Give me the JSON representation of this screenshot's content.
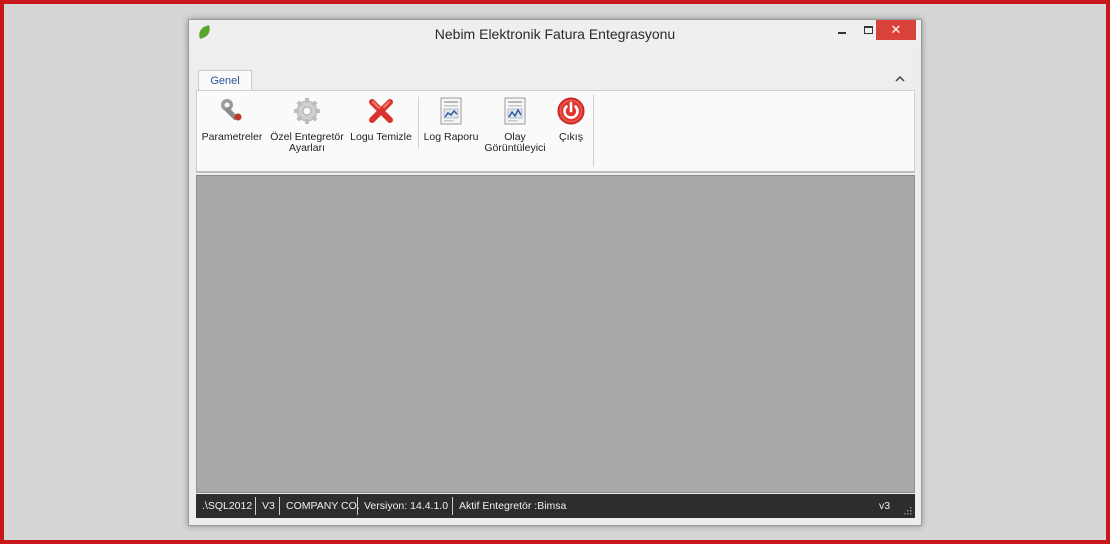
{
  "window": {
    "title": "Nebim Elektronik Fatura Entegrasyonu",
    "close_glyph": "✕"
  },
  "ribbon": {
    "tabs": [
      {
        "label": "Genel",
        "active": true
      }
    ],
    "buttons": [
      {
        "label_line1": "Parametreler",
        "label_line2": "",
        "icon": "wrench-icon"
      },
      {
        "label_line1": "Özel Entegretör",
        "label_line2": "Ayarları",
        "icon": "gear-icon"
      },
      {
        "label_line1": "Logu Temizle",
        "label_line2": "",
        "icon": "red-x-icon"
      },
      {
        "label_line1": "Log Raporu",
        "label_line2": "",
        "icon": "report-icon"
      },
      {
        "label_line1": "Olay",
        "label_line2": "Görüntüleyici",
        "icon": "event-viewer-icon"
      },
      {
        "label_line1": "Çıkış",
        "label_line2": "",
        "icon": "power-icon"
      }
    ]
  },
  "statusbar": {
    "server": ".\\SQL2012",
    "db": "V3",
    "company": "COMPANY CO.",
    "version": "Versiyon: 14.4.1.0",
    "integrator": "Aktif Entegretör :Bimsa",
    "right": "v3"
  },
  "colors": {
    "frame_red": "#c8161d",
    "close_red": "#d9413b",
    "workspace_gray": "#a8a8a8",
    "statusbar_dark": "#2d2d2d",
    "tab_text_blue": "#2b5797"
  }
}
